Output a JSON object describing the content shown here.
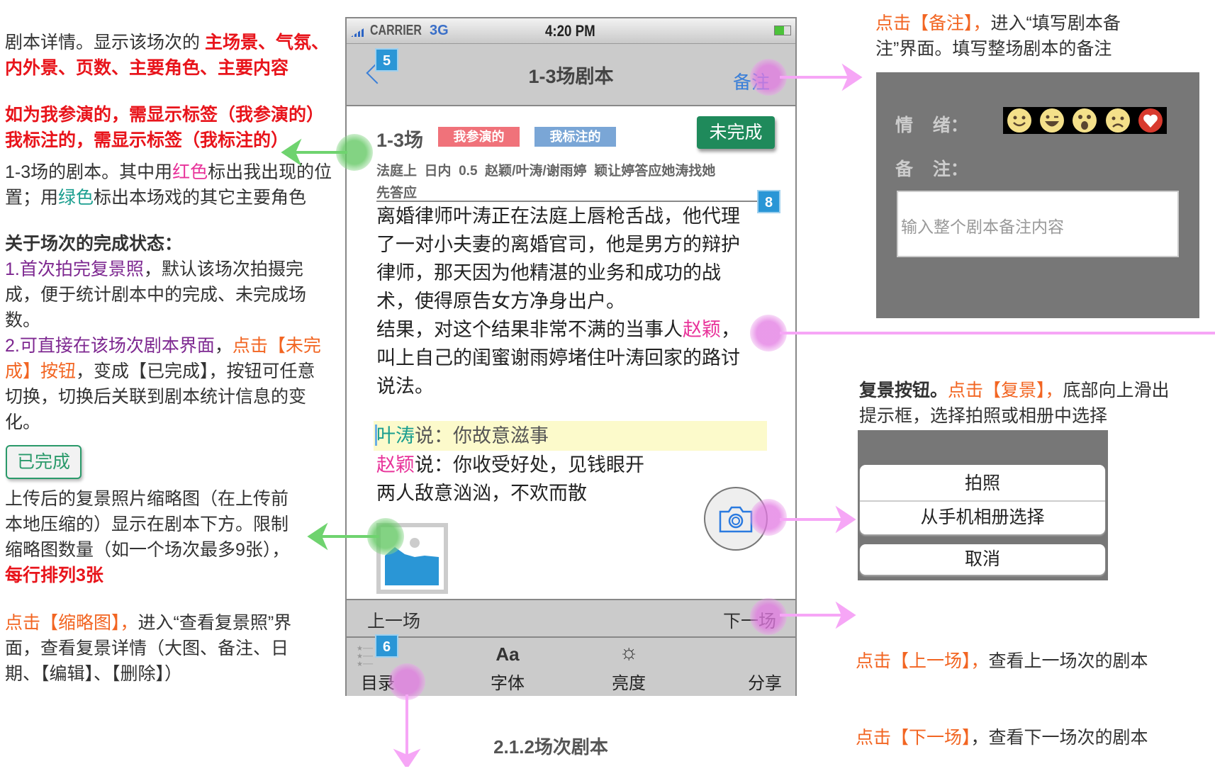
{
  "left_annotations": [
    {
      "segments": [
        {
          "t": "剧本详情。显示该场次的 ",
          "c": ""
        },
        {
          "t": "主场景、气氛、\n内外景、页数、主要角色、主要内容",
          "c": "c-red"
        }
      ]
    },
    {
      "segments": [
        {
          "t": "如为我参演的，需显示标签（我参演的）\n我标注的，需显示标签（我标注的）",
          "c": "c-red"
        }
      ]
    },
    {
      "segments": [
        {
          "t": "1-3场的剧本。其中用",
          "c": ""
        },
        {
          "t": "红色",
          "c": "c-pink"
        },
        {
          "t": "标出我出现的位\n置；用",
          "c": ""
        },
        {
          "t": "绿色",
          "c": "c-teal"
        },
        {
          "t": "标出本场戏的其它主要角色",
          "c": ""
        }
      ]
    },
    {
      "segments": [
        {
          "t": "关于场次的完成状态：\n",
          "c": "c-bold"
        },
        {
          "t": "1.首次拍完复景照",
          "c": "c-purple"
        },
        {
          "t": "，默认该场次拍摄完\n成，便于统计剧本中的完成、未完成场\n数。\n",
          "c": ""
        },
        {
          "t": "2.可直接在该场次剧本界面",
          "c": "c-purple"
        },
        {
          "t": "，",
          "c": ""
        },
        {
          "t": "点击【未完\n成】按钮",
          "c": "c-orange"
        },
        {
          "t": "，变成【已完成】，按钮可任意\n切换，切换后关联到剧本统计信息的变\n化。",
          "c": ""
        }
      ]
    },
    {
      "segments": [
        {
          "t": "上传后的复景照片缩略图（在上传前\n本地压缩的）显示在剧本下方。限制\n缩略图数量（如一个场次最多9张），\n",
          "c": ""
        },
        {
          "t": "每行排列3张",
          "c": "c-red"
        }
      ]
    },
    {
      "segments": [
        {
          "t": "点击【缩略图】，",
          "c": "c-orange"
        },
        {
          "t": "进入“查看复景照”界\n面，查看复景详情（大图、备注、日\n期、【编辑】、【删除】）",
          "c": ""
        }
      ]
    }
  ],
  "done_button_label": "已完成",
  "phone": {
    "status": {
      "carrier": "CARRIER",
      "network": "3G",
      "time": "4:20 PM"
    },
    "nav": {
      "title": "1-3场剧本",
      "note_button": "备注",
      "badge": "5"
    },
    "scene": {
      "number": "1-3场",
      "tag_acted": "我参演的",
      "tag_marked": "我标注的",
      "status_button": "未完成",
      "meta": "法庭上  日内  0.5  赵颖/叶涛/谢雨婷  颖让婷答应她涛找她\n先答应",
      "badge": "8"
    },
    "script": {
      "paragraph": "离婚律师叶涛正在法庭上唇枪舌战，他代理\n了一对小夫妻的离婚官司，他是男方的辩护\n律师，那天因为他精湛的业务和成功的战\n术，使得原告女方净身出户。",
      "result_before": "结果，对这个结果非常不满的当事人",
      "result_name": "赵颖",
      "result_after": "，\n叫上自己的闺蜜谢雨婷堵住叶涛回家的路讨\n说法。",
      "line1_speaker": "叶涛",
      "line1_text": "说：你故意滋事",
      "line2_speaker": "赵颖",
      "line2_text": "说：你收受好处，见钱眼开",
      "line3": "两人敌意汹汹，不欢而散"
    },
    "prev_scene": "上一场",
    "next_scene": "下一场",
    "tabs": [
      {
        "label": "目录",
        "icon": "list-icon"
      },
      {
        "label": "字体",
        "icon": "font-icon",
        "glyph": "Aa"
      },
      {
        "label": "亮度",
        "icon": "brightness-icon",
        "glyph": "☼"
      },
      {
        "label": "分享",
        "icon": "share-icon"
      }
    ],
    "tab_badge": "6"
  },
  "caption": "2.1.2场次剧本",
  "note_panel": {
    "desc_action": "点击【备注】，",
    "desc_rest": "进入“填写剧本备\n注”界面。填写整场剧本的备注",
    "mood_label": "情    绪：",
    "note_label": "备    注：",
    "placeholder": "输入整个剧本备注内容"
  },
  "photo_panel": {
    "desc_bold": "复景按钮。",
    "desc_action": "点击【复景】，",
    "desc_rest": "底部向上滑出\n提示框，选择拍照或相册中选择",
    "take_photo": "拍照",
    "choose_album": "从手机相册选择",
    "cancel": "取消"
  },
  "nav_notes": {
    "prev_action": "点击【上一场】，",
    "prev_rest": "查看上一场次的剧本",
    "next_action": "点击【下一场】",
    "next_rest": "，查看下一场次的剧本"
  },
  "colors": {
    "accent_blue": "#3a7fd8",
    "done_green": "#1f8a5b",
    "tag_red": "#f0727a",
    "tag_blue": "#7aa6d6",
    "annot_pink": "#f6a6f6",
    "annot_green": "#6fd36f"
  }
}
